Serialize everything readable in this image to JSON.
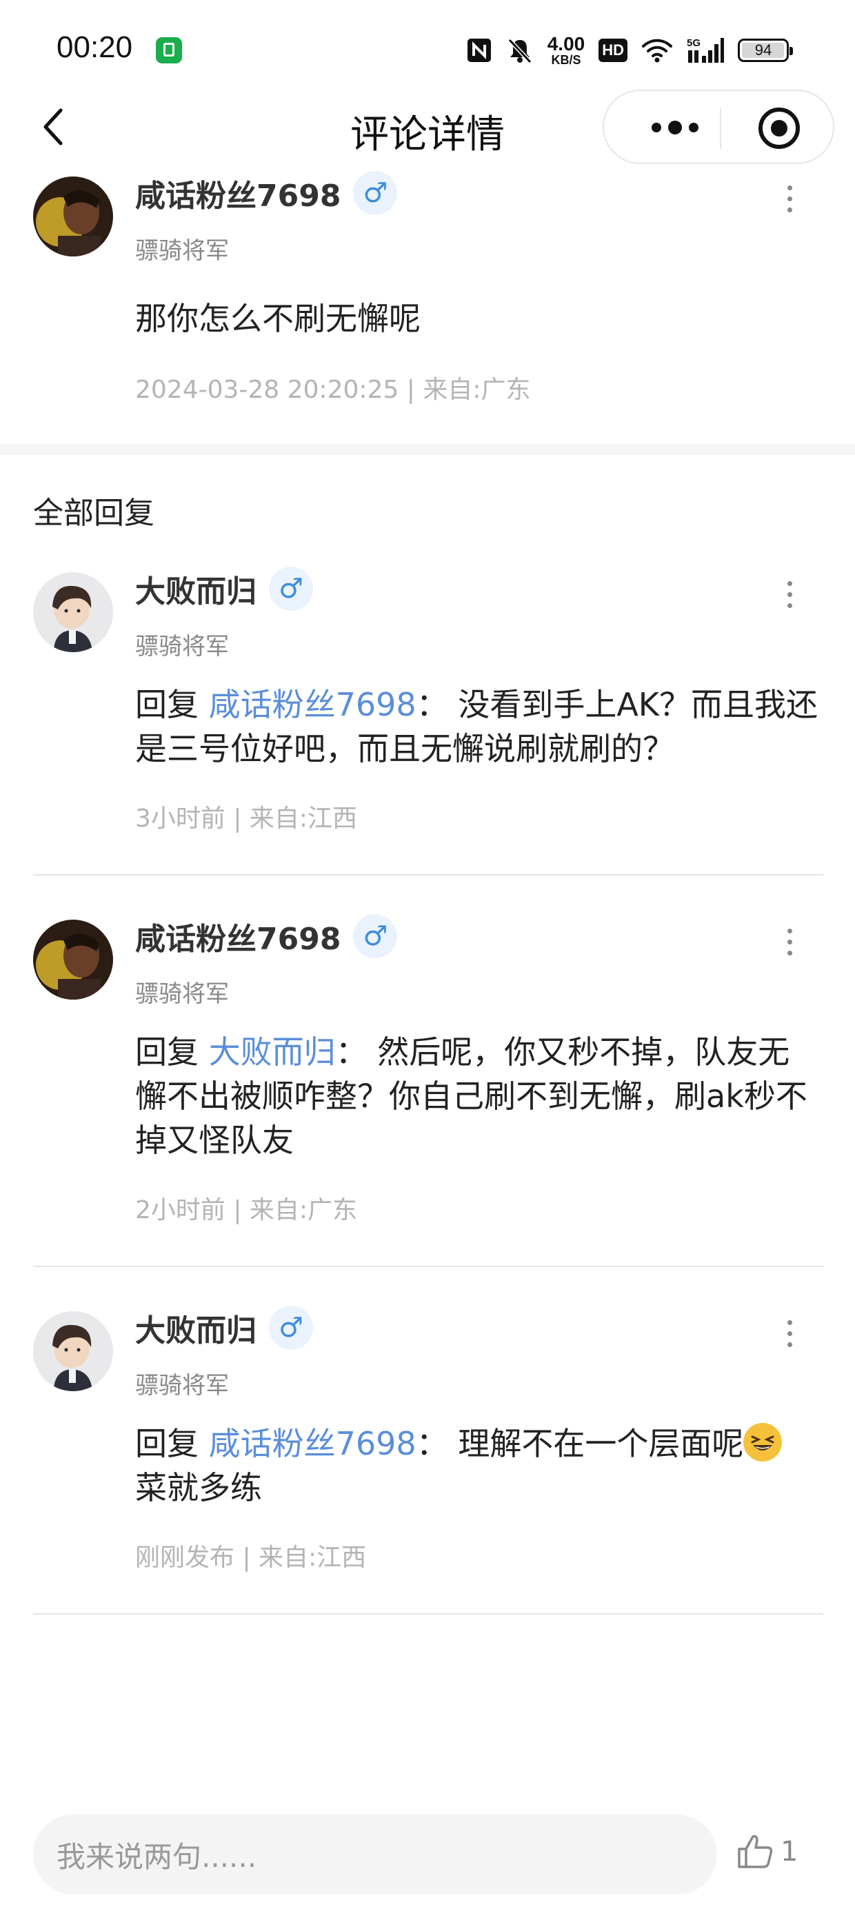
{
  "status_bar": {
    "time": "00:20",
    "net_speed_value": "4.00",
    "net_speed_unit": "KB/S",
    "hd_label": "HD",
    "signal_label": "5G",
    "battery": "94"
  },
  "nav": {
    "title": "评论详情"
  },
  "main_comment": {
    "author": "咸话粉丝7698",
    "gender_icon": "male-icon",
    "rank": "骠骑将军",
    "text": "那你怎么不刷无懈呢",
    "meta": "2024-03-28 20:20:25 | 来自:广东"
  },
  "replies_section": {
    "title": "全部回复"
  },
  "replies": [
    {
      "author": "大败而归",
      "rank": "骠骑将军",
      "reply_prefix": "回复 ",
      "reply_to": "咸话粉丝7698",
      "colon": "：",
      "text": "没看到手上AK？而且我还是三号位好吧，而且无懈说刷就刷的？",
      "meta": "3小时前 | 来自:江西"
    },
    {
      "author": "咸话粉丝7698",
      "rank": "骠骑将军",
      "reply_prefix": "回复 ",
      "reply_to": "大败而归",
      "colon": "：",
      "text": "然后呢，你又秒不掉，队友无懈不出被顺咋整？你自己刷不到无懈，刷ak秒不掉又怪队友",
      "meta": "2小时前 | 来自:广东"
    },
    {
      "author": "大败而归",
      "rank": "骠骑将军",
      "reply_prefix": "回复 ",
      "reply_to": "咸话粉丝7698",
      "colon": "：",
      "text_before_emoji": "理解不在一个层面呢",
      "emoji": "grinning-squinting-face",
      "text_after_emoji": "菜就多练",
      "meta": "刚刚发布 | 来自:江西"
    }
  ],
  "bottom_bar": {
    "input_placeholder": "我来说两句......",
    "like_count": "1"
  },
  "colors": {
    "mention": "#5b8ed9",
    "gender_badge_bg": "#eaf3fd",
    "gender_icon": "#3f8de0",
    "meta_text": "#b4b4b4"
  }
}
